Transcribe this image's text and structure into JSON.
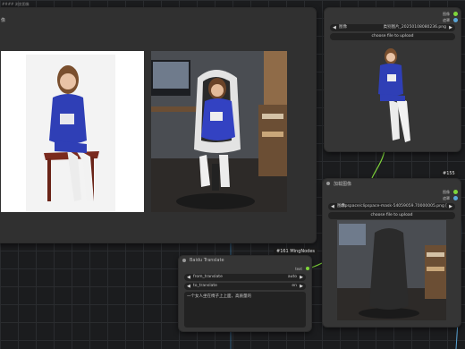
{
  "top_left_label": "#### 浏览图像",
  "preview_node": {
    "title": "像"
  },
  "load_image_top": {
    "outputs": [
      "图像",
      "遮罩"
    ],
    "image_label": "图像",
    "image_value": "类别图片_20250108080236.png",
    "upload_label": "choose file to upload"
  },
  "load_image_mask": {
    "badge": "#155",
    "title": "加载图像",
    "outputs": [
      "图像",
      "遮罩"
    ],
    "image_label": "图像",
    "image_value": "clipspace/clipspace-mask-54059059.70000005.png [",
    "upload_label": "choose file to upload"
  },
  "translate_node": {
    "badge": "#161 MingNodes",
    "title": "Baidu Translate",
    "output_label": "text",
    "from_label": "from_translate",
    "from_value": "auto",
    "to_label": "to_translate",
    "to_value": "en",
    "input_text": "一个女人坐在椅子上上面，高质量的"
  },
  "colors": {
    "node_bg": "#353535",
    "widget_bg": "#222222",
    "link_green": "#7fd63a",
    "link_blue": "#5aa6d8",
    "grid": "#2a2c2f"
  }
}
